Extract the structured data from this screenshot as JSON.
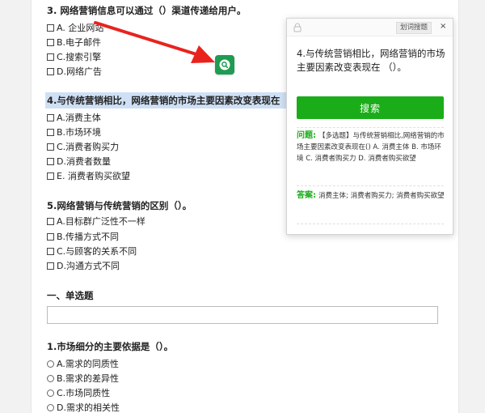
{
  "questions": [
    {
      "title": "3. 网络营销信息可以通过（）渠道传递给用户。",
      "options": [
        "A. 企业网站",
        "B.电子邮件",
        "C.搜索引擎",
        "D.网络广告"
      ]
    },
    {
      "title": "4.与传统营销相比，网络营销的市场主要因素改变表现在 （）。",
      "options": [
        "A.消费主体",
        "B.市场环境",
        "C.消费者购买力",
        "D.消费者数量",
        "E. 消费者购买欲望"
      ]
    },
    {
      "title": "5.网络营销与传统营销的区别（）。",
      "options": [
        "A.目标群广泛性不一样",
        "B.传播方式不同",
        "C.与顾客的关系不同",
        "D.沟通方式不同"
      ]
    }
  ],
  "section_title": "一、单选题",
  "text_input_value": "",
  "question_single": {
    "title": "1.市场细分的主要依据是（）。",
    "options": [
      "A.需求的同质性",
      "B.需求的差异性",
      "C.市场同质性",
      "D.需求的相关性"
    ]
  },
  "panel": {
    "tag": "划词搜题",
    "close": "×",
    "question": "4.与传统营销相比，网络营销的市场主要因素改变表现在 （）。",
    "search_label": "搜索",
    "q_label": "问题:",
    "q_text": "【多选题】与传统营销相比,网络营销的市场主要因素改变表现在() A. 消费主体 B. 市场环境 C. 消费者购买力 D. 消费者购买欲望",
    "a_label": "答案:",
    "a_text": "消费主体; 消费者购买力; 消费者购买欲望"
  },
  "colors": {
    "accent_green": "#1aad19",
    "highlight_blue": "#cfe0f5",
    "arrow_red": "#e8231e"
  },
  "icons": {
    "floating_button": "search-icon",
    "panel_lock": "lock-icon",
    "panel_close": "close-icon"
  }
}
